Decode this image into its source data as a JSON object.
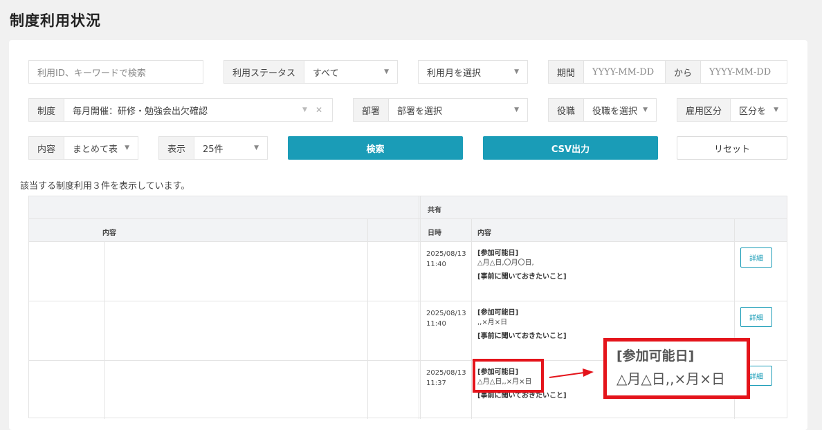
{
  "page": {
    "title": "制度利用状況"
  },
  "filters": {
    "search": {
      "placeholder": "利用ID、キーワードで検索"
    },
    "status": {
      "label": "利用ステータス",
      "value": "すべて"
    },
    "month": {
      "placeholder": "利用月を選択"
    },
    "period": {
      "label": "期間",
      "from_placeholder": "YYYY-MM-DD",
      "sep": "から",
      "to_placeholder": "YYYY-MM-DD"
    },
    "system": {
      "label": "制度",
      "value": "毎月開催：研修・勉強会出欠確認"
    },
    "department": {
      "label": "部署",
      "placeholder": "部署を選択"
    },
    "position": {
      "label": "役職",
      "placeholder": "役職を選択"
    },
    "employment": {
      "label": "雇用区分",
      "placeholder": "区分を"
    },
    "content": {
      "label": "内容",
      "value": "まとめて表"
    },
    "display": {
      "label": "表示",
      "value": "25件"
    }
  },
  "buttons": {
    "search": "検索",
    "csv": "CSV出力",
    "reset": "リセット"
  },
  "result_text": "該当する制度利用３件を表示しています。",
  "table": {
    "group_header": "共有",
    "col_content_left": "内容",
    "col_datetime": "日時",
    "col_content": "内容",
    "detail_label": "詳細",
    "rows": [
      {
        "date": "2025/08/13",
        "time": "11:40",
        "avail_label": "[参加可能日]",
        "avail_value": "△月△日,〇月〇日,",
        "question_label": "[事前に聞いておきたいこと]"
      },
      {
        "date": "2025/08/13",
        "time": "11:40",
        "avail_label": "[参加可能日]",
        "avail_value": ",,×月×日",
        "question_label": "[事前に聞いておきたいこと]"
      },
      {
        "date": "2025/08/13",
        "time": "11:37",
        "avail_label": "[参加可能日]",
        "avail_value": "△月△日,,×月×日",
        "question_label": "[事前に聞いておきたいこと]"
      }
    ]
  },
  "callout": {
    "label": "[参加可能日]",
    "value": "△月△日,,×月×日"
  }
}
